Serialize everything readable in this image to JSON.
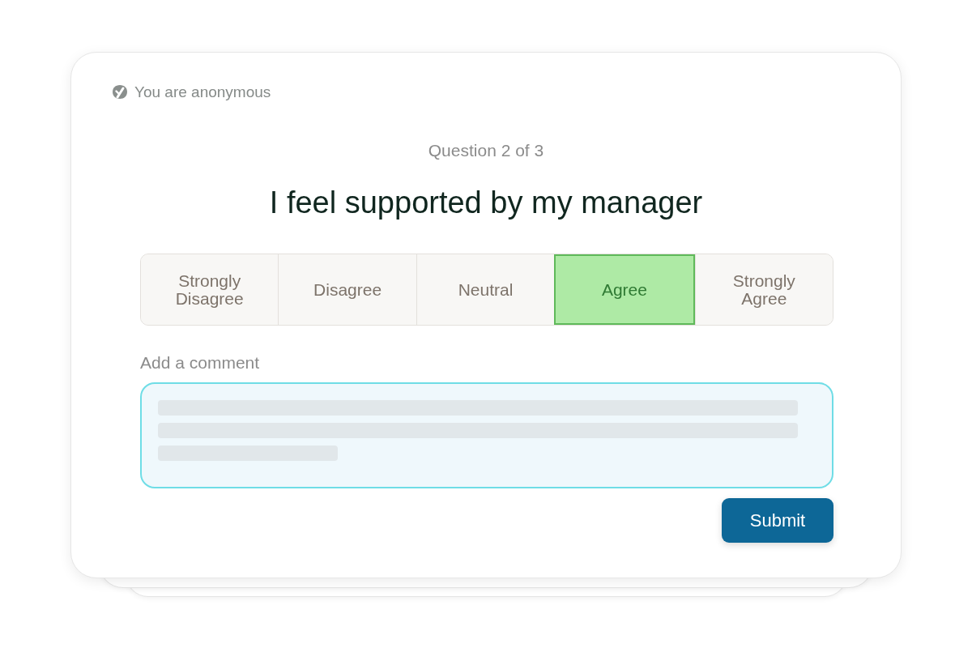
{
  "privacy_note": {
    "label": "You are anonymous"
  },
  "progress": "Question 2 of 3",
  "question": "I feel supported by my manager",
  "options": [
    {
      "label": "Strongly Disagree",
      "selected": false
    },
    {
      "label": "Disagree",
      "selected": false
    },
    {
      "label": "Neutral",
      "selected": false
    },
    {
      "label": "Agree",
      "selected": true
    },
    {
      "label": "Strongly Agree",
      "selected": false
    }
  ],
  "comment": {
    "label": "Add a comment"
  },
  "buttons": [
    "Submit"
  ]
}
